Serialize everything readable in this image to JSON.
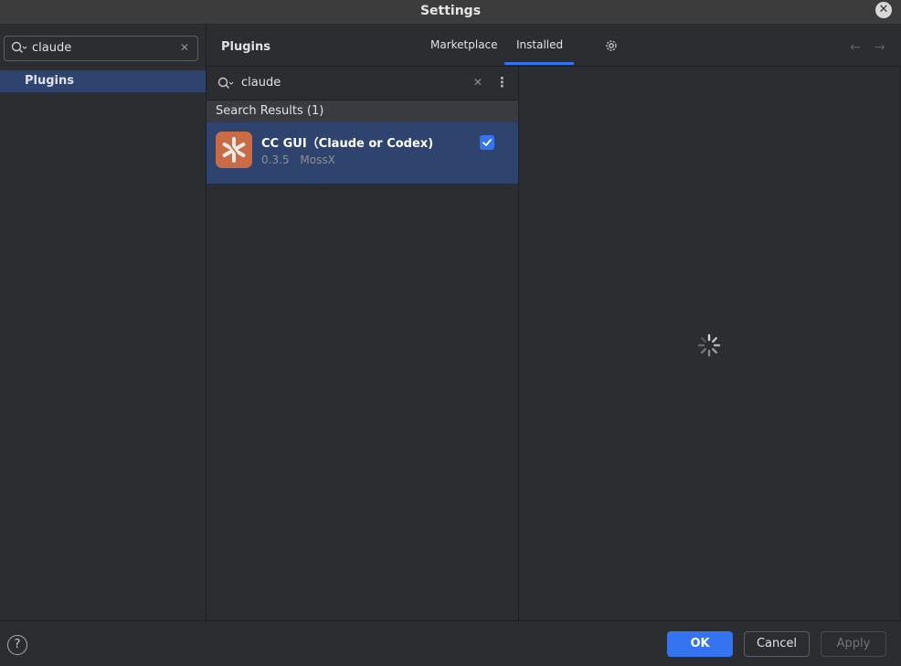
{
  "window": {
    "title": "Settings",
    "close_glyph": "✕"
  },
  "sidebar": {
    "search": {
      "value": "claude",
      "clear_glyph": "✕"
    },
    "items": [
      {
        "label": "Plugins",
        "selected": true
      }
    ]
  },
  "header": {
    "title": "Plugins",
    "tabs": [
      {
        "label": "Marketplace",
        "active": false
      },
      {
        "label": "Installed",
        "active": true
      }
    ],
    "back_glyph": "←",
    "forward_glyph": "→"
  },
  "plugin_list": {
    "search": {
      "value": "claude",
      "clear_glyph": "✕",
      "more_glyph": "⋮"
    },
    "results_header": "Search Results (1)",
    "items": [
      {
        "name": "CC GUI（Claude or Codex)",
        "version": "0.3.5",
        "vendor": "MossX",
        "enabled": true,
        "icon": "claude-logo-icon"
      }
    ]
  },
  "footer": {
    "help_glyph": "?",
    "ok_label": "OK",
    "cancel_label": "Cancel",
    "apply_label": "Apply"
  },
  "colors": {
    "accent": "#3574f0",
    "selection": "#2e436e",
    "background": "#2b2d30",
    "plugin_icon": "#c96b45"
  }
}
